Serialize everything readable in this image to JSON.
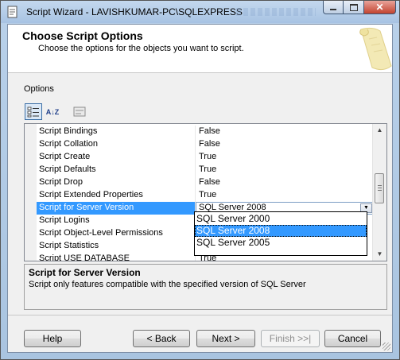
{
  "window": {
    "title": "Script Wizard - LAVISHKUMAR-PC\\SQLEXPRESS",
    "controls": {
      "minimize": "minimize-icon",
      "maximize": "maximize-icon",
      "close": "✕"
    }
  },
  "header": {
    "title": "Choose Script Options",
    "subtitle": "Choose the options for the objects you want to script."
  },
  "options_label": "Options",
  "toolbar": {
    "categorized_icon": "categorized-icon",
    "sort_alpha_label": "A↓Z",
    "property_pages_icon": "property-pages-icon"
  },
  "properties": [
    {
      "name": "Script Bindings",
      "value": "False"
    },
    {
      "name": "Script Collation",
      "value": "False"
    },
    {
      "name": "Script Create",
      "value": "True"
    },
    {
      "name": "Script Defaults",
      "value": "True"
    },
    {
      "name": "Script Drop",
      "value": "False"
    },
    {
      "name": "Script Extended Properties",
      "value": "True"
    },
    {
      "name": "Script for Server Version",
      "value": "SQL Server 2008"
    },
    {
      "name": "Script Logins",
      "value": ""
    },
    {
      "name": "Script Object-Level Permissions",
      "value": ""
    },
    {
      "name": "Script Statistics",
      "value": ""
    },
    {
      "name": "Script USE DATABASE",
      "value": "True"
    }
  ],
  "server_version_dropdown": {
    "options": [
      "SQL Server 2000",
      "SQL Server 2008",
      "SQL Server 2005"
    ],
    "selected": "SQL Server 2008"
  },
  "description": {
    "title": "Script for Server Version",
    "text": "Script only features compatible with the specified version of SQL Server"
  },
  "buttons": {
    "help": "Help",
    "back": "< Back",
    "next": "Next >",
    "finish": "Finish >>|",
    "cancel": "Cancel"
  },
  "colors": {
    "selection": "#3399ff",
    "title_bar": "#b9d1ea"
  }
}
